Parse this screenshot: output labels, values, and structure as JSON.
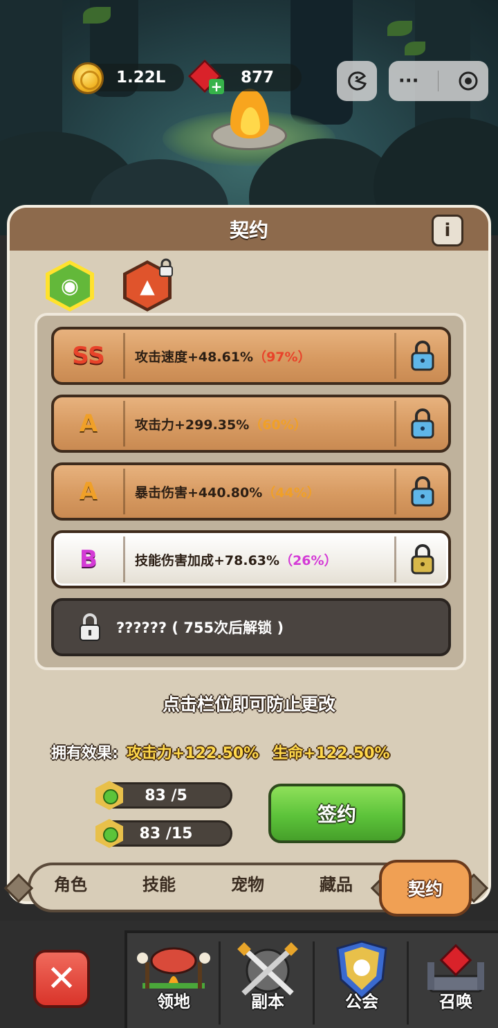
{
  "currency": {
    "gold": "1.22L",
    "gems": "877",
    "gold_icon": "gold-coin-icon",
    "gem_icon": "ruby-gem-icon"
  },
  "system": {
    "more_label": "···",
    "game_icon": "pacman-icon",
    "record_icon": "record-target-icon"
  },
  "panel": {
    "title": "契约",
    "info_label": "i",
    "pets": [
      {
        "icon": "ghost-pet-icon",
        "selected": true
      },
      {
        "icon": "cat-pet-icon",
        "locked": true
      }
    ],
    "slots": [
      {
        "grade": "SS",
        "grade_color": "#e8432a",
        "stat": "攻击速度+48.61%",
        "pct": "（97%）",
        "pct_color": "#e8432a",
        "style": "wood"
      },
      {
        "grade": "A",
        "grade_color": "#f0a028",
        "stat": "攻击力+299.35%",
        "pct": "（60%）",
        "pct_color": "#f0a028",
        "style": "wood"
      },
      {
        "grade": "A",
        "grade_color": "#f0a028",
        "stat": "暴击伤害+440.80%",
        "pct": "（44%）",
        "pct_color": "#f0a028",
        "style": "wood"
      },
      {
        "grade": "B",
        "grade_color": "#d43ad6",
        "stat": "技能伤害加成+78.63%",
        "pct": "（26%）",
        "pct_color": "#d43ad6",
        "style": "white"
      }
    ],
    "locked_slot": "?????? ( 755次后解锁 )",
    "hint": "点击栏位即可防止更改",
    "effects_label": "拥有效果:",
    "effect_1": "攻击力+122.50%",
    "effect_2": "生命+122.50%",
    "costs": [
      "83 /5",
      "83 /15"
    ],
    "sign_button": "签约"
  },
  "tabs": [
    "角色",
    "技能",
    "宠物",
    "藏品",
    "契约"
  ],
  "active_tab": "契约",
  "nav": {
    "close_label": "✕",
    "items": [
      "领地",
      "副本",
      "公会",
      "召唤"
    ]
  },
  "colors": {
    "panel_bg": "#d8cdb8",
    "header_bg": "#8d6a4c",
    "accent_gold": "#ffd84a",
    "button_green": "#5cc33a"
  }
}
